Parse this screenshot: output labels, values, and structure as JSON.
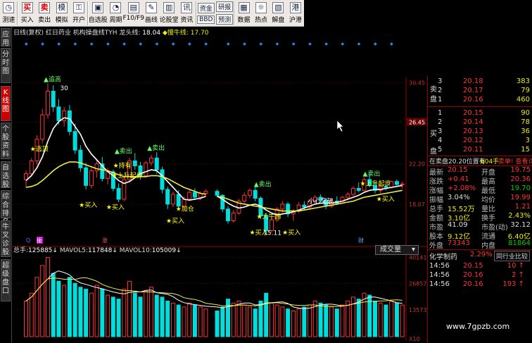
{
  "toolbar": {
    "items": [
      {
        "label": "测速",
        "icon": "gauge-icon",
        "glyph": "◷"
      },
      {
        "label": "买入",
        "icon": "buy-icon",
        "glyph": "买",
        "red": true
      },
      {
        "label": "卖出",
        "icon": "sell-icon",
        "glyph": "卖",
        "red": true
      },
      {
        "label": "模拟",
        "icon": "simulate-icon",
        "glyph": "模"
      },
      {
        "label": "开户",
        "icon": "lock-icon",
        "glyph": "⚿"
      },
      {
        "label": "自选股",
        "icon": "watchlist-icon",
        "glyph": "▣"
      },
      {
        "label": "周期",
        "icon": "period-icon",
        "glyph": "◔"
      },
      {
        "label": "F10/F9",
        "icon": "f10-icon",
        "glyph": "▤"
      },
      {
        "label": "画线",
        "icon": "draw-icon",
        "glyph": "✎"
      },
      {
        "label": "论股堂",
        "icon": "forum-icon",
        "glyph": "▥"
      },
      {
        "label": "资讯",
        "icon": "news-icon",
        "glyph": "讯"
      }
    ],
    "stack1": [
      "资金",
      "BBD"
    ],
    "stack2": [
      "研报",
      "预测"
    ],
    "items2": [
      {
        "label": "数据",
        "icon": "data-icon",
        "glyph": "▦"
      },
      {
        "label": "热点",
        "icon": "hot-icon",
        "glyph": "☼"
      },
      {
        "label": "解盘",
        "icon": "analysis-icon",
        "glyph": "▧"
      },
      {
        "label": "沪港",
        "icon": "hk-icon",
        "glyph": "港"
      }
    ]
  },
  "sidebar": [
    "应用",
    "分时图",
    "K线图",
    "个股资料",
    "自选股",
    "综合排名",
    "牛叉诊股",
    "超级盘口"
  ],
  "header": {
    "period": "日线(复权)",
    "name": "红日药业",
    "indicator": "机构操盘线TYH",
    "long_label": "龙头线:",
    "long_val": "18.04",
    "bull_label": "◆慢牛线:",
    "bull_val": "17.70"
  },
  "price_axis": [
    "30.45",
    "26.45",
    "22.20",
    "18.07"
  ],
  "annotations": {
    "chase": "追高",
    "dd": "逃顶",
    "sell": "卖出",
    "buy": "买入",
    "hold": "持有",
    "up": "上升起步",
    "addpos": "加仓",
    "big": "大牛蹄",
    "low": "15.11",
    "smart": "小心突破",
    "top_price": "30"
  },
  "markers": {
    "q": "Q",
    "ban": "振",
    "zhen": "涨",
    "cai": "财"
  },
  "volume": {
    "label": "总手:",
    "total": "125885",
    "ma5_label": "MAVOL5:",
    "ma5": "117848",
    "ma10_label": "MAVOL10:",
    "ma10": "105009",
    "axis": [
      "40141",
      "26857",
      "13573",
      "X10"
    ],
    "dropdown": "成交量"
  },
  "orderbook": {
    "sells": [
      {
        "lvl": "3",
        "px": "20.18",
        "vol": "383"
      },
      {
        "lvl": "2",
        "px": "20.17",
        "vol": "79"
      },
      {
        "lvl": "1",
        "px": "20.16",
        "vol": "460"
      }
    ],
    "sell_tag": "卖",
    "buys": [
      {
        "lvl": "1",
        "px": "20.15",
        "vol": "90"
      },
      {
        "lvl": "2",
        "px": "20.14",
        "vol": "78"
      },
      {
        "lvl": "3",
        "px": "20.13",
        "vol": "36"
      },
      {
        "lvl": "4",
        "px": "20.12",
        "vol": "3"
      },
      {
        "lvl": "5",
        "px": "20.11",
        "vol": "15"
      }
    ],
    "buy_tag": "买",
    "buy_tag2": "盘",
    "sell_tag2": "盘"
  },
  "status": {
    "text": "在卖盘20.20位置有",
    "vol": "604手",
    "tip": "卖单! 查看详细"
  },
  "quote": [
    {
      "l": "最新",
      "v": "20.15",
      "vc": "up",
      "l2": "开盘",
      "v2": "19.75",
      "v2c": "up"
    },
    {
      "l": "涨跌",
      "v": "+0.41",
      "vc": "up",
      "l2": "最高",
      "v2": "20.36",
      "v2c": "up"
    },
    {
      "l": "涨幅",
      "v": "+2.08%",
      "vc": "up",
      "l2": "最低",
      "v2": "19.70",
      "v2c": "dn"
    },
    {
      "l": "振幅",
      "v": "3.04%",
      "vc": "wh",
      "l2": "均价",
      "v2": "19.99",
      "v2c": "up"
    },
    {
      "l": "总手",
      "v": "15.52万",
      "vc": "yl",
      "l2": "量比",
      "v2": "1.21",
      "v2c": "up"
    },
    {
      "l": "金额",
      "v": "3.10亿",
      "vc": "yl",
      "l2": "换手",
      "v2": "2.43%",
      "v2c": "yl"
    },
    {
      "l": "市盈",
      "v": "41.09",
      "vc": "wh",
      "l2": "市盈(动)",
      "v2": "32.12",
      "v2c": "wh"
    },
    {
      "l": "股本",
      "v": "9.12亿",
      "vc": "yl",
      "l2": "流通",
      "v2": "6.40亿",
      "v2c": "yl"
    },
    {
      "l": "外盘",
      "v": "73343",
      "vc": "up",
      "l2": "内盘",
      "v2": "81864",
      "v2c": "dn"
    }
  ],
  "sector": {
    "name": "化学制药",
    "pct": "2.29%",
    "tab": "同行业比较"
  },
  "ticks": [
    {
      "t": "14:56",
      "p": "20.15",
      "v": "10"
    },
    {
      "t": "14:56",
      "p": "20.16",
      "v": "2"
    },
    {
      "t": "14:56",
      "p": "20.16",
      "v": "193"
    }
  ],
  "watermark": "www.7gpzb.com",
  "colors": {
    "up": "#ff3333",
    "down": "#00cccc",
    "ma_white": "#ffffff",
    "ma_yellow": "#eeee44",
    "accent": "#cc0000"
  },
  "chart_data": {
    "type": "candlestick",
    "series_note": "candles (o,h,l,c) with volumes",
    "candles": [
      [
        20.6,
        21.5,
        19.8,
        21.2
      ],
      [
        21.2,
        22.8,
        20.9,
        22.5
      ],
      [
        22.5,
        25.1,
        22.1,
        24.7
      ],
      [
        24.7,
        27.8,
        24.3,
        27.2
      ],
      [
        27.2,
        30.4,
        26.8,
        29.6
      ],
      [
        29.6,
        30.2,
        27.5,
        28.0
      ],
      [
        28.0,
        28.8,
        26.2,
        26.6
      ],
      [
        26.6,
        28.0,
        26.0,
        27.6
      ],
      [
        27.6,
        28.2,
        25.1,
        25.5
      ],
      [
        25.5,
        26.3,
        23.2,
        23.6
      ],
      [
        23.6,
        24.1,
        21.4,
        21.8
      ],
      [
        21.8,
        22.3,
        19.6,
        20.0
      ],
      [
        20.0,
        21.9,
        19.7,
        21.5
      ],
      [
        21.5,
        22.6,
        20.8,
        22.2
      ],
      [
        22.2,
        22.9,
        20.4,
        20.7
      ],
      [
        20.7,
        21.8,
        20.1,
        21.4
      ],
      [
        21.4,
        21.6,
        19.4,
        19.7
      ],
      [
        19.7,
        20.2,
        18.3,
        18.6
      ],
      [
        18.6,
        20.9,
        18.4,
        20.6
      ],
      [
        20.6,
        22.8,
        20.4,
        22.5
      ],
      [
        22.5,
        23.3,
        21.6,
        22.0
      ],
      [
        22.0,
        22.4,
        20.6,
        21.0
      ],
      [
        21.0,
        22.5,
        20.8,
        22.3
      ],
      [
        22.3,
        23.1,
        22.0,
        22.8
      ],
      [
        22.8,
        23.4,
        21.2,
        21.6
      ],
      [
        21.6,
        21.9,
        19.2,
        19.6
      ],
      [
        19.6,
        19.9,
        17.6,
        18.1
      ],
      [
        18.1,
        19.4,
        17.8,
        19.1
      ],
      [
        19.1,
        19.5,
        17.6,
        17.9
      ],
      [
        17.9,
        18.9,
        17.5,
        18.6
      ],
      [
        18.6,
        19.6,
        18.4,
        19.3
      ],
      [
        19.3,
        19.7,
        18.6,
        18.8
      ],
      [
        18.8,
        19.4,
        18.5,
        19.2
      ],
      [
        19.2,
        19.6,
        18.9,
        19.4
      ],
      [
        19.4,
        19.6,
        18.8,
        19.0
      ],
      [
        19.0,
        19.1,
        17.3,
        17.6
      ],
      [
        17.6,
        17.9,
        16.1,
        16.4
      ],
      [
        16.4,
        17.5,
        16.2,
        17.2
      ],
      [
        17.2,
        18.6,
        17.0,
        18.4
      ],
      [
        18.4,
        19.3,
        18.2,
        19.0
      ],
      [
        19.0,
        19.7,
        18.7,
        19.5
      ],
      [
        19.5,
        19.8,
        18.4,
        18.7
      ],
      [
        18.7,
        18.9,
        16.6,
        16.9
      ],
      [
        16.9,
        17.2,
        15.1,
        15.4
      ],
      [
        15.4,
        16.8,
        15.2,
        16.5
      ],
      [
        16.5,
        17.8,
        16.3,
        17.6
      ],
      [
        17.6,
        18.4,
        17.2,
        18.1
      ],
      [
        18.1,
        18.3,
        16.8,
        17.1
      ],
      [
        17.1,
        17.6,
        16.4,
        17.4
      ],
      [
        17.4,
        18.3,
        17.2,
        18.0
      ],
      [
        18.0,
        18.4,
        17.5,
        17.8
      ],
      [
        17.8,
        18.6,
        17.6,
        18.4
      ],
      [
        18.4,
        19.0,
        18.2,
        18.8
      ],
      [
        18.8,
        19.1,
        18.3,
        18.5
      ],
      [
        18.5,
        18.7,
        17.6,
        17.9
      ],
      [
        17.9,
        18.6,
        17.7,
        18.4
      ],
      [
        18.4,
        18.9,
        18.0,
        18.2
      ],
      [
        18.2,
        18.9,
        18.1,
        18.8
      ],
      [
        18.8,
        19.3,
        18.5,
        19.1
      ],
      [
        19.1,
        19.9,
        18.9,
        19.7
      ],
      [
        19.7,
        20.3,
        19.3,
        19.5
      ],
      [
        19.5,
        20.8,
        19.4,
        20.6
      ],
      [
        20.6,
        21.1,
        19.8,
        20.0
      ],
      [
        20.0,
        20.4,
        19.2,
        19.5
      ],
      [
        19.5,
        20.1,
        19.2,
        19.9
      ],
      [
        19.9,
        20.2,
        19.5,
        19.8
      ],
      [
        19.8,
        20.5,
        19.7,
        20.4
      ],
      [
        20.4,
        20.6,
        19.9,
        20.1
      ],
      [
        20.1,
        20.4,
        19.7,
        20.15
      ]
    ],
    "volumes": [
      18,
      22,
      30,
      36,
      40,
      32,
      28,
      26,
      30,
      27,
      25,
      24,
      22,
      26,
      24,
      21,
      20,
      19,
      24,
      28,
      22,
      20,
      23,
      25,
      21,
      20,
      18,
      17,
      16,
      15,
      17,
      16,
      15,
      14,
      13,
      15,
      19,
      17,
      18,
      16,
      15,
      14,
      18,
      22,
      17,
      16,
      15,
      14,
      13,
      14,
      15,
      16,
      18,
      17,
      16,
      15,
      14,
      16,
      18,
      20,
      19,
      22,
      21,
      18,
      17,
      16,
      18,
      17,
      16
    ],
    "ma_white": [
      20.5,
      21.0,
      21.8,
      22.9,
      24.5,
      25.8,
      26.5,
      26.9,
      26.8,
      26.0,
      25.2,
      24.0,
      23.2,
      22.6,
      22.0,
      21.4,
      21.0,
      20.5,
      20.2,
      20.4,
      20.8,
      21.2,
      21.4,
      21.6,
      21.5,
      21.0,
      20.4,
      19.8,
      19.2,
      18.6,
      18.5,
      18.6,
      18.7,
      18.9,
      18.9,
      18.6,
      18.2,
      17.9,
      17.7,
      17.8,
      18.0,
      18.1,
      17.9,
      17.5,
      17.2,
      17.0,
      17.1,
      17.2,
      17.3,
      17.5,
      17.7,
      17.9,
      18.1,
      18.2,
      18.2,
      18.2,
      18.3,
      18.4,
      18.6,
      18.8,
      19.0,
      19.3,
      19.5,
      19.6,
      19.6,
      19.7,
      19.8,
      19.9,
      20.0
    ],
    "ma_yellow": [
      19.8,
      19.9,
      20.1,
      20.5,
      21.0,
      21.5,
      21.9,
      22.2,
      22.4,
      22.4,
      22.3,
      22.1,
      21.9,
      21.7,
      21.6,
      21.5,
      21.3,
      21.1,
      20.9,
      20.9,
      20.9,
      20.9,
      20.9,
      21.0,
      21.0,
      20.9,
      20.7,
      20.4,
      20.1,
      19.8,
      19.6,
      19.4,
      19.2,
      19.1,
      18.9,
      18.8,
      18.6,
      18.4,
      18.2,
      18.1,
      18.0,
      17.9,
      17.8,
      17.7,
      17.6,
      17.5,
      17.4,
      17.4,
      17.4,
      17.4,
      17.5,
      17.6,
      17.7,
      17.8,
      17.9,
      18.0,
      18.1,
      18.2,
      18.3,
      18.4,
      18.6,
      18.8,
      18.9,
      19.0,
      19.1,
      19.2,
      19.3,
      19.4,
      19.5
    ],
    "ylim": [
      14.5,
      31.0
    ]
  }
}
